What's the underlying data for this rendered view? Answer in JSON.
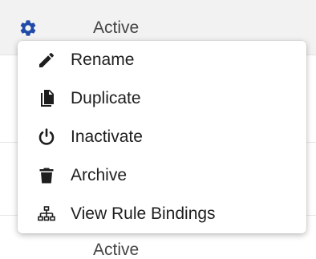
{
  "table": {
    "rows": [
      {
        "status": "Active"
      },
      {
        "status": "Active"
      }
    ]
  },
  "menu": {
    "items": [
      {
        "label": "Rename",
        "icon": "pencil-icon"
      },
      {
        "label": "Duplicate",
        "icon": "copy-icon"
      },
      {
        "label": "Inactivate",
        "icon": "power-icon"
      },
      {
        "label": "Archive",
        "icon": "trash-icon"
      },
      {
        "label": "View Rule Bindings",
        "icon": "sitemap-icon"
      }
    ]
  },
  "colors": {
    "gear": "#1f4aa8",
    "icon": "#1e1e1e",
    "header_bg": "#f2f2f2"
  }
}
